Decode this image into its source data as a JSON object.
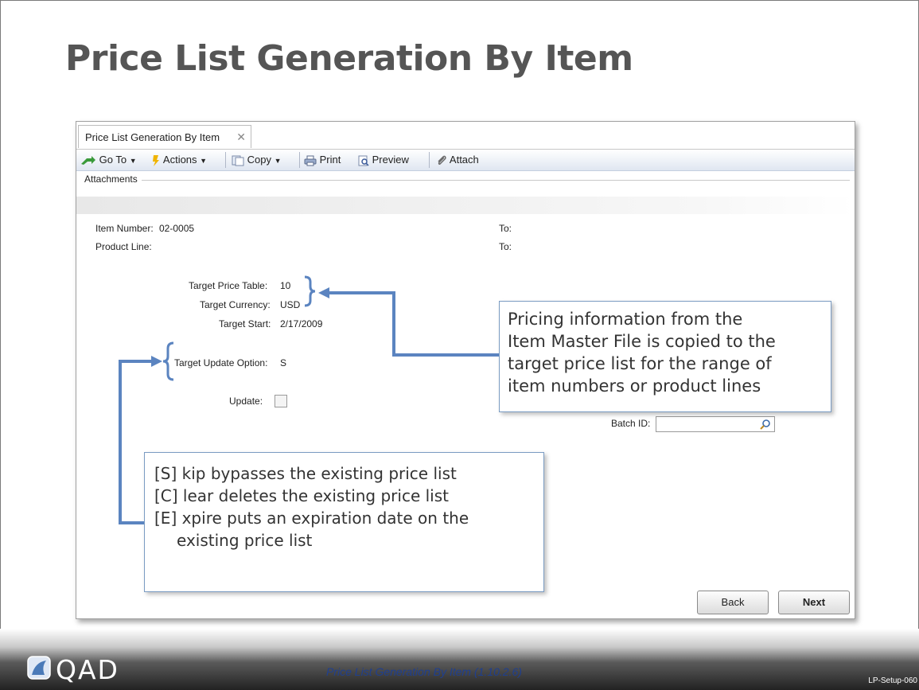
{
  "slide": {
    "title": "Price List Generation By Item",
    "footer_caption": "Price List Generation By Item (1.10.2.6)",
    "slide_id": "LP-Setup-060",
    "logo_text": "QAD"
  },
  "window": {
    "tab_label": "Price List Generation By Item",
    "close_symbol": "✕",
    "toolbar": {
      "goto": "Go To",
      "actions": "Actions",
      "copy": "Copy",
      "print": "Print",
      "preview": "Preview",
      "attach": "Attach"
    },
    "attachments_label": "Attachments"
  },
  "form": {
    "item_number_label": "Item Number:",
    "item_number_value": "02-0005",
    "to_label_1": "To:",
    "product_line_label": "Product Line:",
    "to_label_2": "To:",
    "target_price_table_label": "Target Price Table:",
    "target_price_table_value": "10",
    "target_currency_label": "Target Currency:",
    "target_currency_value": "USD",
    "target_start_label": "Target Start:",
    "target_start_value": "2/17/2009",
    "target_update_option_label": "Target Update Option:",
    "target_update_option_value": "S",
    "update_label": "Update:",
    "batch_id_label": "Batch ID:",
    "back_button": "Back",
    "next_button": "Next"
  },
  "callouts": {
    "pricing": [
      "Pricing information from the",
      "Item Master File is copied to the",
      "target price list for the range of",
      "item numbers or product lines"
    ],
    "options": [
      "[S] kip bypasses the existing price list",
      "[C] lear deletes the existing price list",
      "[E] xpire puts an expiration date on the",
      "existing price list"
    ]
  },
  "colors": {
    "callout_border": "#7a9bc2",
    "arrow": "#5b84c0",
    "title": "#555555"
  }
}
